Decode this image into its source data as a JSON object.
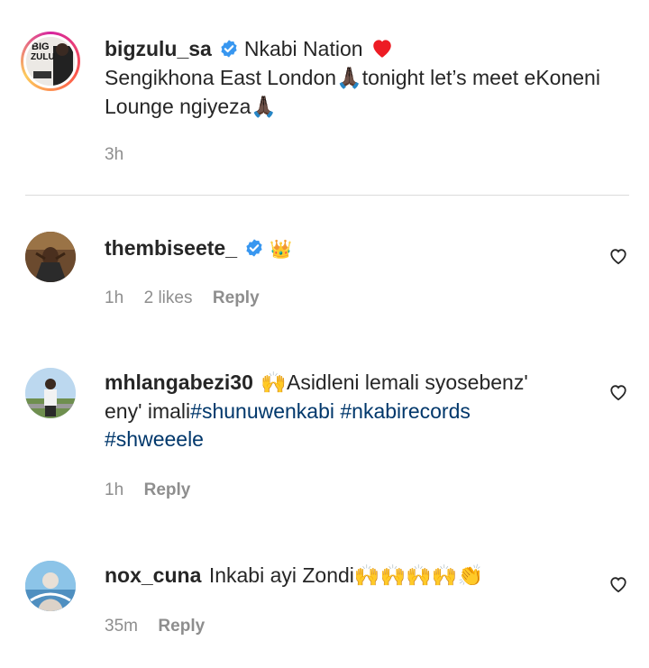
{
  "post": {
    "username": "bigzulu_sa",
    "caption_line1": "Nkabi Nation",
    "caption_line1_emoji": "❤",
    "caption_line2": "Sengikhona East London",
    "caption_line2_emoji": "🙏🏿",
    "caption_line2_rest": "tonight let’s meet eKoneni",
    "caption_line3": "Lounge ngiyeza",
    "caption_line3_emoji": "🙏🏿",
    "time": "3h",
    "avatar_text_top": "BIG",
    "avatar_text_bottom": "ZULU"
  },
  "comments": [
    {
      "username": "thembiseete_",
      "verified": true,
      "text": "👑",
      "time": "1h",
      "likes": "2 likes",
      "reply_label": "Reply"
    },
    {
      "username": "mhlangabezi30",
      "verified": false,
      "emoji": "🙌",
      "text_line1": "Asidleni lemali syosebenz'",
      "text_line2": "eny' imali",
      "hashtag1": "#shunuwenkabi",
      "hashtag2": "#nkabirecords",
      "hashtag3": "#shweeele",
      "time": "1h",
      "reply_label": "Reply"
    },
    {
      "username": "nox_cuna",
      "verified": false,
      "text": "Inkabi ayi Zondi",
      "emoji": "🙌🙌🙌🙌👏",
      "time": "35m",
      "reply_label": "Reply"
    }
  ],
  "colors": {
    "text": "#262626",
    "secondary": "#8e8e8e",
    "hashtag": "#00376b",
    "verified": "#3897f0",
    "heart_red": "#ed1c24"
  },
  "icons": {
    "verified": "verified-badge-icon",
    "like": "heart-outline-icon"
  }
}
